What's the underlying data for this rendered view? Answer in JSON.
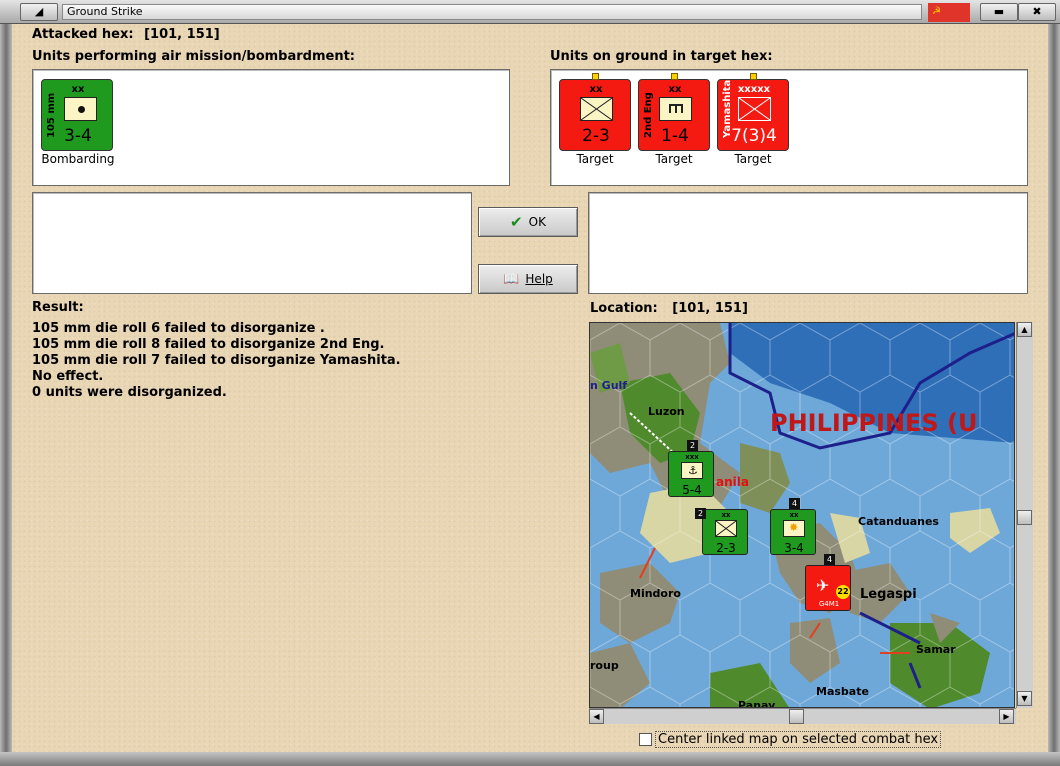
{
  "window": {
    "title": "Ground Strike"
  },
  "header": {
    "attacked_hex_label": "Attacked hex:",
    "attacked_hex_value": "[101, 151]"
  },
  "air_units": {
    "heading": "Units performing air mission/bombardment:",
    "units": [
      {
        "name": "105 mm",
        "size": "xx",
        "strength": "3-4",
        "status": "Bombarding",
        "color": "#1f9a1f"
      }
    ]
  },
  "ground_units": {
    "heading": "Units on ground in target hex:",
    "units": [
      {
        "name": "",
        "size": "xx",
        "strength": "2-3",
        "status": "Target",
        "color": "#f41a12"
      },
      {
        "name": "2nd Eng",
        "size": "xx",
        "strength": "1-4",
        "status": "Target",
        "color": "#f41a12"
      },
      {
        "name": "Yamashita",
        "size": "xxxxx",
        "strength": "7(3)4",
        "status": "Target",
        "color": "#f41a12"
      }
    ]
  },
  "buttons": {
    "ok": "OK",
    "help": "Help"
  },
  "result": {
    "heading": "Result:",
    "lines": [
      "105 mm die roll 6 failed to disorganize .",
      "105 mm die roll 8 failed to disorganize 2nd Eng.",
      "105 mm die roll 7 failed to disorganize Yamashita.",
      "No effect.",
      "0 units were disorganized."
    ]
  },
  "location": {
    "label": "Location:",
    "value": "[101, 151]"
  },
  "map": {
    "labels": {
      "gulf": "n Gulf",
      "luzon": "Luzon",
      "manila": "anila",
      "philippines": "PHILIPPINES (U",
      "catanduanes": "Catanduanes",
      "legaspi": "Legaspi",
      "mindoro": "Mindoro",
      "samar": "Samar",
      "group": "roup",
      "masbate": "Masbate",
      "panay": "Panay"
    },
    "counters": [
      {
        "size": "xxx",
        "strength": "5-4",
        "stack": "2",
        "color": "#1f9a1f"
      },
      {
        "size": "xx",
        "strength": "2-3",
        "stack": "2",
        "color": "#1f9a1f"
      },
      {
        "size": "xx",
        "strength": "3-4",
        "stack": "4",
        "color": "#1f9a1f"
      },
      {
        "size": "",
        "strength": "22",
        "stack": "4",
        "color": "#f41a12",
        "name": "G4M1"
      }
    ],
    "colors": {
      "ocean": "#6ea8d8",
      "deep_ocean": "#2f6fb8",
      "land": "#9c9a86",
      "forest": "#4f8a2c",
      "friendly": "#1f9a1f",
      "enemy": "#f41a12",
      "border": "#1d1f8a"
    }
  },
  "footer": {
    "checkbox_label": "Center linked map on selected combat hex",
    "checkbox_checked": false
  }
}
